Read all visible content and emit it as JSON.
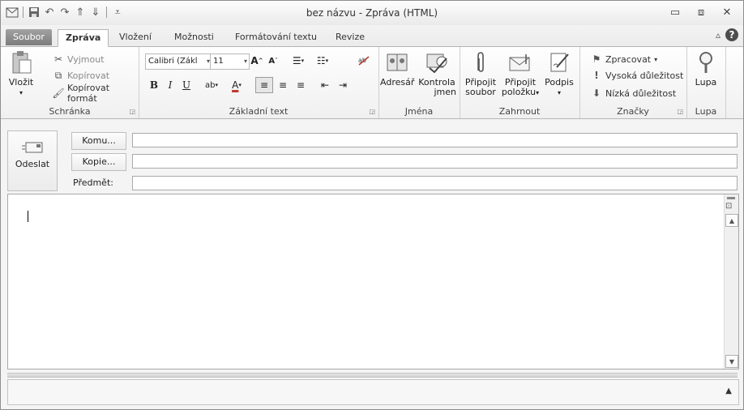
{
  "window": {
    "title": "bez názvu - Zpráva (HTML)",
    "controls": [
      "minimize",
      "restore",
      "close"
    ]
  },
  "tabs": [
    {
      "label": "Soubor",
      "type": "file"
    },
    {
      "label": "Zpráva",
      "type": "active"
    },
    {
      "label": "Vložení",
      "type": "normal"
    },
    {
      "label": "Možnosti",
      "type": "normal"
    },
    {
      "label": "Formátování textu",
      "type": "normal"
    },
    {
      "label": "Revize",
      "type": "normal"
    }
  ],
  "ribbon": {
    "clipboard": {
      "paste": "Vložit",
      "cut": "Vyjmout",
      "copy": "Kopírovat",
      "format_painter": "Kopírovat formát",
      "label": "Schránka"
    },
    "basic_text": {
      "font": "Calibri (Zákl",
      "size": "11",
      "label": "Základní text"
    },
    "names": {
      "address_book": "Adresář",
      "check_names_1": "Kontrola",
      "check_names_2": "jmen",
      "label": "Jména"
    },
    "include": {
      "attach_file_1": "Připojit",
      "attach_file_2": "soubor",
      "attach_item_1": "Připojit",
      "attach_item_2": "položku",
      "signature": "Podpis",
      "label": "Zahrnout"
    },
    "tags": {
      "follow_up": "Zpracovat",
      "high_importance": "Vysoká důležitost",
      "low_importance": "Nízká důležitost",
      "label": "Značky"
    },
    "zoom": {
      "zoom": "Lupa",
      "label": "Lupa"
    }
  },
  "compose": {
    "send": "Odeslat",
    "to_button": "Komu...",
    "cc_button": "Kopie...",
    "subject_label": "Předmět:",
    "to_value": "",
    "cc_value": "",
    "subject_value": ""
  },
  "colors": {
    "file_tab": "#8a8a8a",
    "red_accent": "#c0392b"
  }
}
